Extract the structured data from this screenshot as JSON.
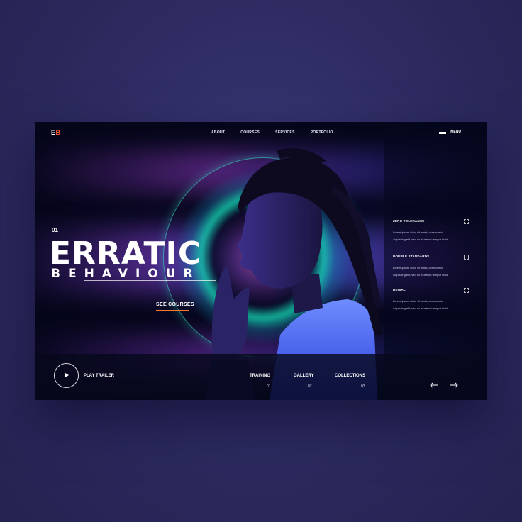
{
  "brand": {
    "logo_e": "E",
    "logo_b": "B"
  },
  "nav": {
    "items": [
      "ABOUT",
      "COURSES",
      "SERVICES",
      "PORTFOLIO"
    ],
    "menu_label": "MENU"
  },
  "hero": {
    "slide_number": "01",
    "title": "ERRATIC",
    "subtitle": "BEHAVIOUR",
    "cta": "SEE COURSES"
  },
  "features": [
    {
      "title": "ZERO TOLERANCE",
      "line1": "Lorem ipsum dolor sit amet, consectetur",
      "line2": "adipiscing elit, sed do eiusmod tempor incidi"
    },
    {
      "title": "DOUBLE STANDARDS",
      "line1": "Lorem ipsum dolor sit amet, consectetur",
      "line2": "adipiscing elit, sed do eiusmod tempor incidi"
    },
    {
      "title": "DENIAL",
      "line1": "Lorem ipsum dolor sit amet, consectetur",
      "line2": "adipiscing elit, sed do eiusmod tempor incidi"
    }
  ],
  "bottom": {
    "play_label": "PLAY TRAILER",
    "tabs": [
      {
        "label": "TRAINING",
        "num": "01"
      },
      {
        "label": "GALLERY",
        "num": "02"
      },
      {
        "label": "COLLECTIONS",
        "num": "03"
      }
    ],
    "prev_icon": "arrow-left-icon",
    "next_icon": "arrow-right-icon"
  },
  "colors": {
    "accent": "#ff7a2e",
    "logo_accent": "#ff5a36",
    "teal_glow": "#2de0c0",
    "background": "#05061a"
  }
}
